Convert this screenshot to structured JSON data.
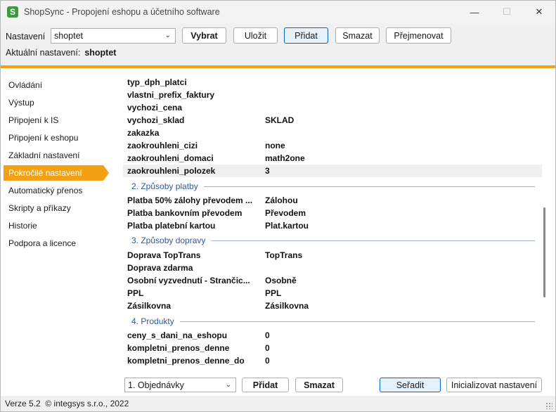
{
  "window": {
    "title": "ShopSync - Propojení eshopu a účetního software",
    "icon": "shopsync-logo-icon",
    "controls": {
      "minimize": "—",
      "maximize": "☐",
      "close": "✕"
    }
  },
  "toolbar": {
    "settings_label": "Nastavení",
    "settings_value": "shoptet",
    "buttons": {
      "select": "Vybrat",
      "save": "Uložit",
      "add": "Přidat",
      "delete": "Smazat",
      "rename": "Přejmenovat"
    },
    "current_label": "Aktuální nastavení:",
    "current_value": "shoptet"
  },
  "sidebar": {
    "items": [
      {
        "label": "Ovládání"
      },
      {
        "label": "Výstup"
      },
      {
        "label": "Připojení k IS"
      },
      {
        "label": "Připojení k eshopu"
      },
      {
        "label": "Základní nastavení"
      },
      {
        "label": "Pokročilé nastavení",
        "selected": true
      },
      {
        "label": "Automatický přenos"
      },
      {
        "label": "Skripty a příkazy"
      },
      {
        "label": "Historie"
      },
      {
        "label": "Podpora a licence"
      }
    ]
  },
  "grid": {
    "rows_top": [
      {
        "key": "typ_dph_platci",
        "value": ""
      },
      {
        "key": "vlastni_prefix_faktury",
        "value": ""
      },
      {
        "key": "vychozi_cena",
        "value": ""
      },
      {
        "key": "vychozi_sklad",
        "value": "SKLAD"
      },
      {
        "key": "zakazka",
        "value": ""
      },
      {
        "key": "zaokrouhleni_cizi",
        "value": "none"
      },
      {
        "key": "zaokrouhleni_domaci",
        "value": "math2one"
      },
      {
        "key": "zaokrouhleni_polozek",
        "value": "3"
      }
    ],
    "section_payment": "2. Způsoby platby",
    "rows_payment": [
      {
        "key": "Platba 50% zálohy převodem ...",
        "value": "Zálohou"
      },
      {
        "key": "Platba bankovním převodem",
        "value": "Převodem"
      },
      {
        "key": "Platba platební kartou",
        "value": "Plat.kartou"
      }
    ],
    "section_shipping": "3. Způsoby dopravy",
    "rows_shipping": [
      {
        "key": "Doprava TopTrans",
        "value": "TopTrans"
      },
      {
        "key": "Doprava zdarma",
        "value": ""
      },
      {
        "key": "Osobní vyzvednutí - Strančic...",
        "value": "Osobně"
      },
      {
        "key": "PPL",
        "value": "PPL"
      },
      {
        "key": "Zásilkovna",
        "value": "Zásilkovna"
      }
    ],
    "section_products": "4. Produkty",
    "rows_products": [
      {
        "key": "ceny_s_dani_na_eshopu",
        "value": "0"
      },
      {
        "key": "kompletni_prenos_denne",
        "value": "0"
      },
      {
        "key": "kompletni_prenos_denne_do",
        "value": "0"
      }
    ]
  },
  "bottom": {
    "category_value": "1. Objednávky",
    "add": "Přidat",
    "delete": "Smazat",
    "sort": "Seřadit",
    "init": "Inicializovat nastavení"
  },
  "status": {
    "text": "Verze 5.2  © integsys s.r.o., 2022"
  }
}
